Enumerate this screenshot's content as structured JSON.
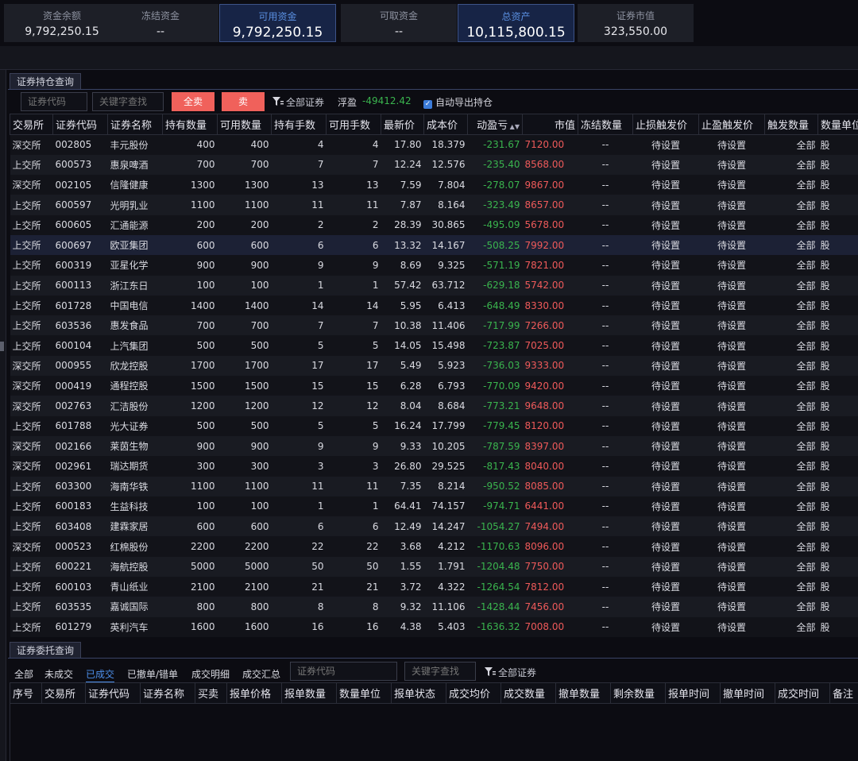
{
  "summary": [
    {
      "label": "资金余额",
      "value": "9,792,250.15",
      "highlight": false
    },
    {
      "label": "冻结资金",
      "value": "--",
      "highlight": false
    },
    {
      "label": "可用资金",
      "value": "9,792,250.15",
      "highlight": true
    },
    {
      "label": "可取资金",
      "value": "--",
      "highlight": false
    },
    {
      "label": "总资产",
      "value": "10,115,800.15",
      "highlight": true
    },
    {
      "label": "证券市值",
      "value": "323,550.00",
      "highlight": false
    }
  ],
  "positions": {
    "tab": "证券持仓查询",
    "code_placeholder": "证券代码",
    "keyword_placeholder": "关键字查找",
    "sell_all_label": "全卖",
    "sell_label": "卖",
    "filter_label": "全部证券",
    "float_pl_label": "浮盈",
    "float_pl_value": "-49412.42",
    "auto_export_label": "自动导出持仓",
    "columns": [
      "交易所",
      "证券代码",
      "证券名称",
      "持有数量",
      "可用数量",
      "持有手数",
      "可用手数",
      "最新价",
      "成本价",
      "动盈亏",
      "市值",
      "冻结数量",
      "止损触发价",
      "止盈触发价",
      "触发数量",
      "数量单位"
    ],
    "rows": [
      [
        "深交所",
        "002805",
        "丰元股份",
        "400",
        "400",
        "4",
        "4",
        "17.80",
        "18.379",
        "-231.67",
        "7120.00",
        "--",
        "待设置",
        "待设置",
        "全部",
        "股"
      ],
      [
        "上交所",
        "600573",
        "惠泉啤酒",
        "700",
        "700",
        "7",
        "7",
        "12.24",
        "12.576",
        "-235.40",
        "8568.00",
        "--",
        "待设置",
        "待设置",
        "全部",
        "股"
      ],
      [
        "深交所",
        "002105",
        "信隆健康",
        "1300",
        "1300",
        "13",
        "13",
        "7.59",
        "7.804",
        "-278.07",
        "9867.00",
        "--",
        "待设置",
        "待设置",
        "全部",
        "股"
      ],
      [
        "上交所",
        "600597",
        "光明乳业",
        "1100",
        "1100",
        "11",
        "11",
        "7.87",
        "8.164",
        "-323.49",
        "8657.00",
        "--",
        "待设置",
        "待设置",
        "全部",
        "股"
      ],
      [
        "上交所",
        "600605",
        "汇通能源",
        "200",
        "200",
        "2",
        "2",
        "28.39",
        "30.865",
        "-495.09",
        "5678.00",
        "--",
        "待设置",
        "待设置",
        "全部",
        "股"
      ],
      [
        "上交所",
        "600697",
        "欧亚集团",
        "600",
        "600",
        "6",
        "6",
        "13.32",
        "14.167",
        "-508.25",
        "7992.00",
        "--",
        "待设置",
        "待设置",
        "全部",
        "股"
      ],
      [
        "上交所",
        "600319",
        "亚星化学",
        "900",
        "900",
        "9",
        "9",
        "8.69",
        "9.325",
        "-571.19",
        "7821.00",
        "--",
        "待设置",
        "待设置",
        "全部",
        "股"
      ],
      [
        "上交所",
        "600113",
        "浙江东日",
        "100",
        "100",
        "1",
        "1",
        "57.42",
        "63.712",
        "-629.18",
        "5742.00",
        "--",
        "待设置",
        "待设置",
        "全部",
        "股"
      ],
      [
        "上交所",
        "601728",
        "中国电信",
        "1400",
        "1400",
        "14",
        "14",
        "5.95",
        "6.413",
        "-648.49",
        "8330.00",
        "--",
        "待设置",
        "待设置",
        "全部",
        "股"
      ],
      [
        "上交所",
        "603536",
        "惠发食品",
        "700",
        "700",
        "7",
        "7",
        "10.38",
        "11.406",
        "-717.99",
        "7266.00",
        "--",
        "待设置",
        "待设置",
        "全部",
        "股"
      ],
      [
        "上交所",
        "600104",
        "上汽集团",
        "500",
        "500",
        "5",
        "5",
        "14.05",
        "15.498",
        "-723.87",
        "7025.00",
        "--",
        "待设置",
        "待设置",
        "全部",
        "股"
      ],
      [
        "深交所",
        "000955",
        "欣龙控股",
        "1700",
        "1700",
        "17",
        "17",
        "5.49",
        "5.923",
        "-736.03",
        "9333.00",
        "--",
        "待设置",
        "待设置",
        "全部",
        "股"
      ],
      [
        "深交所",
        "000419",
        "通程控股",
        "1500",
        "1500",
        "15",
        "15",
        "6.28",
        "6.793",
        "-770.09",
        "9420.00",
        "--",
        "待设置",
        "待设置",
        "全部",
        "股"
      ],
      [
        "深交所",
        "002763",
        "汇洁股份",
        "1200",
        "1200",
        "12",
        "12",
        "8.04",
        "8.684",
        "-773.21",
        "9648.00",
        "--",
        "待设置",
        "待设置",
        "全部",
        "股"
      ],
      [
        "上交所",
        "601788",
        "光大证券",
        "500",
        "500",
        "5",
        "5",
        "16.24",
        "17.799",
        "-779.45",
        "8120.00",
        "--",
        "待设置",
        "待设置",
        "全部",
        "股"
      ],
      [
        "深交所",
        "002166",
        "莱茵生物",
        "900",
        "900",
        "9",
        "9",
        "9.33",
        "10.205",
        "-787.59",
        "8397.00",
        "--",
        "待设置",
        "待设置",
        "全部",
        "股"
      ],
      [
        "深交所",
        "002961",
        "瑞达期货",
        "300",
        "300",
        "3",
        "3",
        "26.80",
        "29.525",
        "-817.43",
        "8040.00",
        "--",
        "待设置",
        "待设置",
        "全部",
        "股"
      ],
      [
        "上交所",
        "603300",
        "海南华铁",
        "1100",
        "1100",
        "11",
        "11",
        "7.35",
        "8.214",
        "-950.52",
        "8085.00",
        "--",
        "待设置",
        "待设置",
        "全部",
        "股"
      ],
      [
        "上交所",
        "600183",
        "生益科技",
        "100",
        "100",
        "1",
        "1",
        "64.41",
        "74.157",
        "-974.71",
        "6441.00",
        "--",
        "待设置",
        "待设置",
        "全部",
        "股"
      ],
      [
        "上交所",
        "603408",
        "建霖家居",
        "600",
        "600",
        "6",
        "6",
        "12.49",
        "14.247",
        "-1054.27",
        "7494.00",
        "--",
        "待设置",
        "待设置",
        "全部",
        "股"
      ],
      [
        "深交所",
        "000523",
        "红棉股份",
        "2200",
        "2200",
        "22",
        "22",
        "3.68",
        "4.212",
        "-1170.63",
        "8096.00",
        "--",
        "待设置",
        "待设置",
        "全部",
        "股"
      ],
      [
        "上交所",
        "600221",
        "海航控股",
        "5000",
        "5000",
        "50",
        "50",
        "1.55",
        "1.791",
        "-1204.48",
        "7750.00",
        "--",
        "待设置",
        "待设置",
        "全部",
        "股"
      ],
      [
        "上交所",
        "600103",
        "青山纸业",
        "2100",
        "2100",
        "21",
        "21",
        "3.72",
        "4.322",
        "-1264.54",
        "7812.00",
        "--",
        "待设置",
        "待设置",
        "全部",
        "股"
      ],
      [
        "上交所",
        "603535",
        "嘉诚国际",
        "800",
        "800",
        "8",
        "8",
        "9.32",
        "11.106",
        "-1428.44",
        "7456.00",
        "--",
        "待设置",
        "待设置",
        "全部",
        "股"
      ],
      [
        "上交所",
        "601279",
        "英利汽车",
        "1600",
        "1600",
        "16",
        "16",
        "4.38",
        "5.403",
        "-1636.32",
        "7008.00",
        "--",
        "待设置",
        "待设置",
        "全部",
        "股"
      ]
    ]
  },
  "orders": {
    "tab": "证券委托查询",
    "sub_tabs": [
      "全部",
      "未成交",
      "已成交",
      "已撤单/错单",
      "成交明细",
      "成交汇总"
    ],
    "active_sub_tab": "已成交",
    "code_placeholder": "证券代码",
    "keyword_placeholder": "关键字查找",
    "filter_label": "全部证券",
    "columns": [
      "序号",
      "交易所",
      "证券代码",
      "证券名称",
      "买卖",
      "报单价格",
      "报单数量",
      "数量单位",
      "报单状态",
      "成交均价",
      "成交数量",
      "撤单数量",
      "剩余数量",
      "报单时间",
      "撤单时间",
      "成交时间",
      "备注"
    ]
  },
  "colors": {
    "loss": "#3ab44e",
    "market_value": "#ef5a5a",
    "accent": "#4b8ee9",
    "sell_button": "#f0615b"
  }
}
